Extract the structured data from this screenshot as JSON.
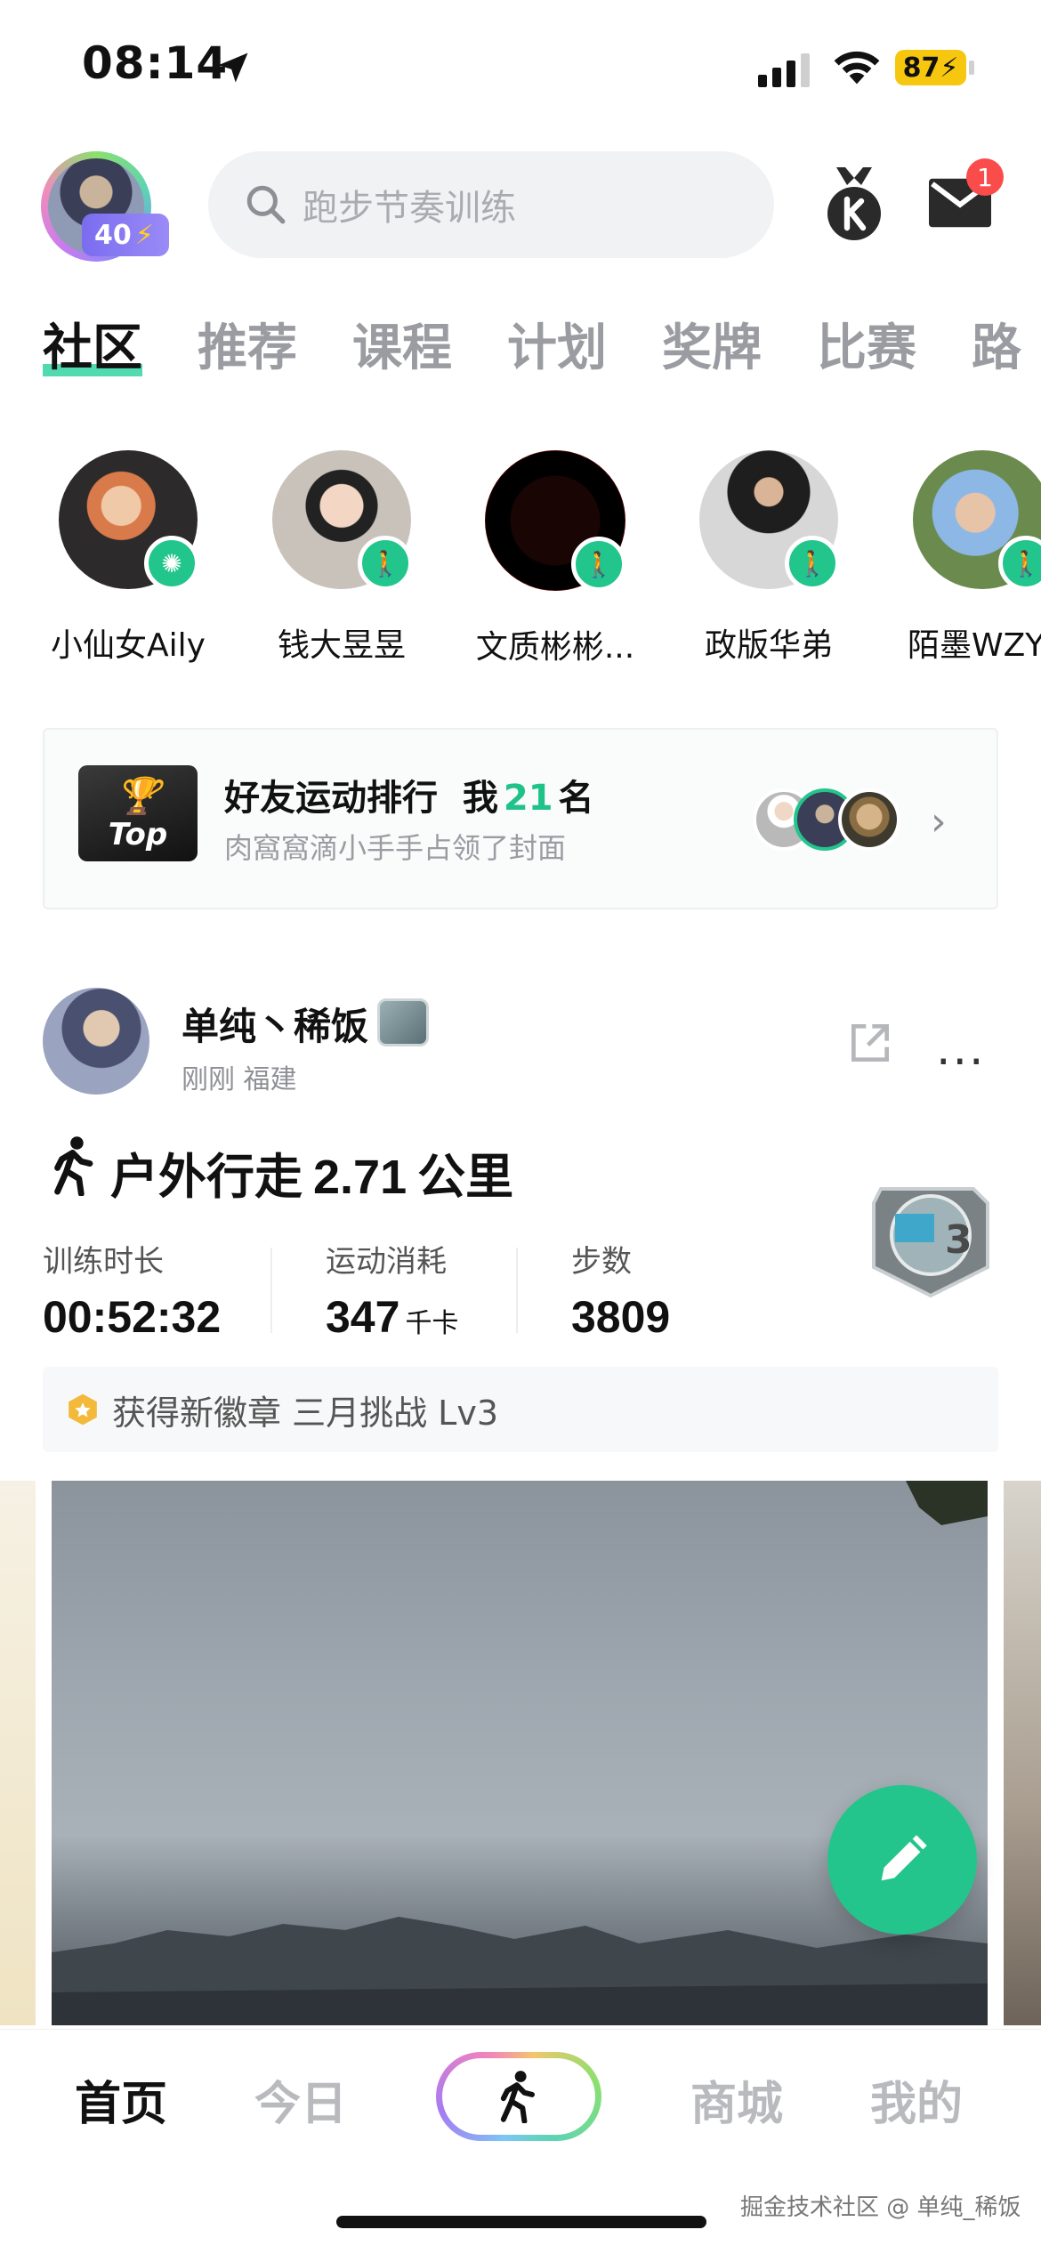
{
  "status_bar": {
    "time": "08:14",
    "battery": "87"
  },
  "header": {
    "level": "40",
    "search_placeholder": "跑步节奏训练",
    "mail_badge": "1"
  },
  "tabs": [
    "社区",
    "推荐",
    "课程",
    "计划",
    "奖牌",
    "比赛",
    "路"
  ],
  "stories": [
    {
      "name": "小仙女Aily"
    },
    {
      "name": "钱大昱昱"
    },
    {
      "name": "文质彬彬..."
    },
    {
      "name": "政版华弟"
    },
    {
      "name": "陌墨WZY"
    }
  ],
  "ranking": {
    "trophy_text": "Top",
    "title_prefix": "好友运动排行",
    "me": "我",
    "rank": "21",
    "rank_suffix": "名",
    "subtitle": "肉窩窩滴小手手占领了封面"
  },
  "post": {
    "author": "单纯丶稀饭",
    "time": "刚刚",
    "location": "福建",
    "activity": "户外行走",
    "distance": "2.71",
    "distance_unit": "公里",
    "stats": [
      {
        "label": "训练时长",
        "value": "00:52:32",
        "unit": ""
      },
      {
        "label": "运动消耗",
        "value": "347",
        "unit": "千卡"
      },
      {
        "label": "步数",
        "value": "3809",
        "unit": ""
      }
    ],
    "badge_text": "获得新徽章 三月挑战 Lv3"
  },
  "bottom_nav": {
    "home": "首页",
    "today": "今日",
    "mall": "商城",
    "mine": "我的"
  },
  "watermark": "掘金技术社区 @ 单纯_稀饭",
  "colors": {
    "accent": "#23c58c",
    "badge_red": "#fb4c4c",
    "battery": "#f7c70f"
  }
}
